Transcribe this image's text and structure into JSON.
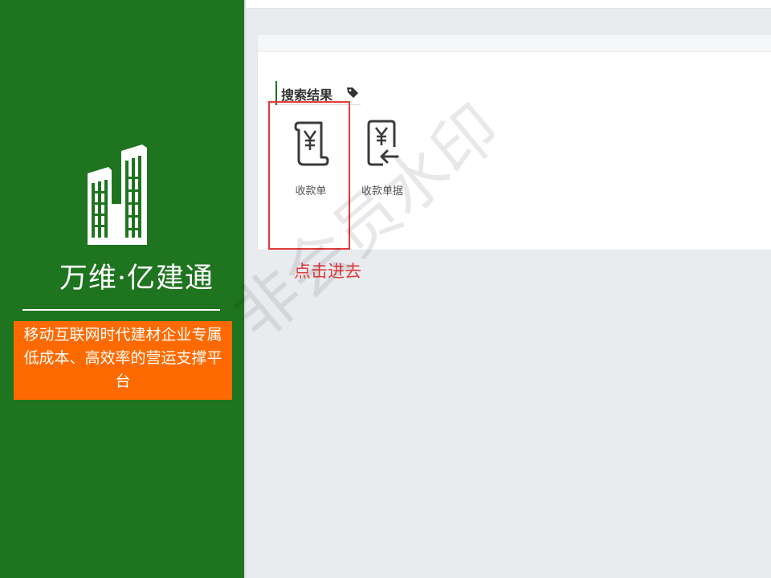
{
  "brand": {
    "title": "万维·亿建通",
    "slogan": "移动互联网时代建材企业专属低成本、高效率的营运支撑平台",
    "logo_icon": "building-logo-icon",
    "panel_color": "#1f741f",
    "slogan_bg": "#ff6a00"
  },
  "search_results": {
    "heading": "搜索结果",
    "tag_icon": "tag-icon",
    "items": [
      {
        "label": "收款单",
        "icon": "receipt-scroll-icon"
      },
      {
        "label": "收款单据",
        "icon": "receipt-document-icon"
      }
    ]
  },
  "annotation": {
    "text": "点击进去",
    "color": "#e43b3b"
  },
  "watermark": {
    "text": "非会员水印"
  }
}
